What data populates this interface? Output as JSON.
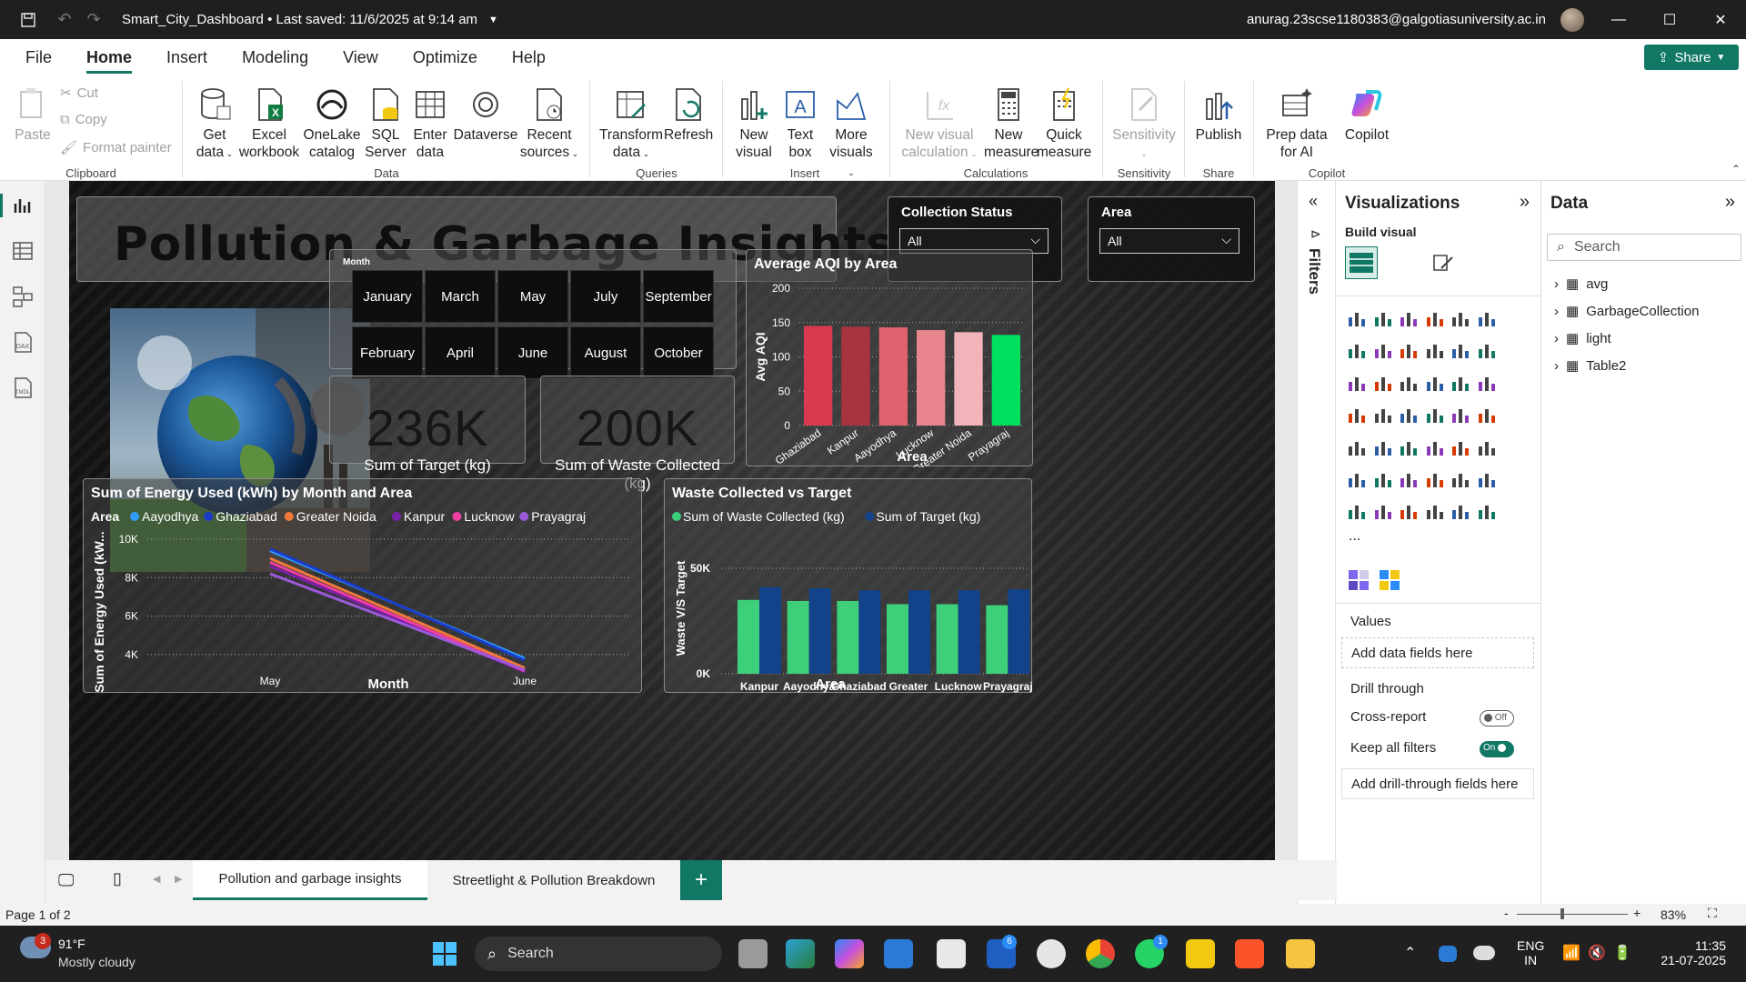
{
  "titlebar": {
    "doc_title": "Smart_City_Dashboard • Last saved: 11/6/2025 at 9:14 am",
    "user": "anurag.23scse1180383@galgotiasuniversity.ac.in"
  },
  "menu": {
    "items": [
      "File",
      "Home",
      "Insert",
      "Modeling",
      "View",
      "Optimize",
      "Help"
    ],
    "share": "Share"
  },
  "ribbon": {
    "clipboard": {
      "paste": "Paste",
      "cut": "Cut",
      "copy": "Copy",
      "format_painter": "Format painter",
      "group": "Clipboard"
    },
    "data": {
      "get_data": "Get data",
      "excel": "Excel workbook",
      "onelake": "OneLake catalog",
      "sql": "SQL Server",
      "enter": "Enter data",
      "dataverse": "Dataverse",
      "recent": "Recent sources",
      "group": "Data"
    },
    "queries": {
      "transform": "Transform data",
      "refresh": "Refresh",
      "group": "Queries"
    },
    "insert": {
      "new_visual": "New visual",
      "text_box": "Text box",
      "more_visuals": "More visuals",
      "group": "Insert"
    },
    "calculations": {
      "new_visual_calc": "New visual calculation",
      "new_measure": "New measure",
      "quick_measure": "Quick measure",
      "group": "Calculations"
    },
    "sensitivity": {
      "label": "Sensitivity",
      "group": "Sensitivity"
    },
    "share": {
      "publish": "Publish",
      "group": "Share"
    },
    "copilot": {
      "prep": "Prep data for AI",
      "copilot": "Copilot",
      "group": "Copilot"
    }
  },
  "report": {
    "title": "Pollution & Garbage Insights",
    "slicer_collection": {
      "label": "Collection Status",
      "value": "All"
    },
    "slicer_area": {
      "label": "Area",
      "value": "All"
    },
    "month_slicer": {
      "label": "Month",
      "months": [
        "January",
        "March",
        "May",
        "July",
        "September",
        "February",
        "April",
        "June",
        "August",
        "October"
      ]
    },
    "kpi_target": {
      "value": "236K",
      "label": "Sum of Target (kg)"
    },
    "kpi_waste": {
      "value": "200K",
      "label": "Sum of Waste Collected (kg)"
    }
  },
  "chart_data": [
    {
      "type": "bar",
      "title": "Average AQI by Area",
      "xlabel": "Area",
      "ylabel": "Avg AQI",
      "ylim": [
        0,
        200
      ],
      "yticks": [
        0,
        50,
        100,
        150,
        200
      ],
      "categories": [
        "Ghaziabad",
        "Kanpur",
        "Aayodhya",
        "Lucknow",
        "Greater Noida",
        "Prayagraj"
      ],
      "values": [
        145,
        144,
        143,
        139,
        136,
        132
      ],
      "colors": [
        "#d93a4f",
        "#a9323f",
        "#e0626f",
        "#e8858e",
        "#f2b3b9",
        "#00e060"
      ]
    },
    {
      "type": "line",
      "title": "Sum of Energy Used (kWh) by Month and Area",
      "xlabel": "Month",
      "ylabel": "Sum of Energy Used (kW...",
      "legend_title": "Area",
      "categories": [
        "May",
        "June"
      ],
      "ylim": [
        3000,
        10000
      ],
      "yticks": [
        "4K",
        "6K",
        "8K",
        "10K"
      ],
      "ytick_values": [
        4000,
        6000,
        8000,
        10000
      ],
      "series": [
        {
          "name": "Aayodhya",
          "color": "#2f9cff",
          "values": [
            9400,
            3800
          ]
        },
        {
          "name": "Ghaziabad",
          "color": "#1a3cc8",
          "values": [
            9500,
            3700
          ]
        },
        {
          "name": "Greater Noida",
          "color": "#f07a3a",
          "values": [
            9000,
            3300
          ]
        },
        {
          "name": "Kanpur",
          "color": "#7a1fa8",
          "values": [
            8600,
            3100
          ]
        },
        {
          "name": "Lucknow",
          "color": "#ee3fa0",
          "values": [
            8800,
            3150
          ]
        },
        {
          "name": "Prayagraj",
          "color": "#9b59d8",
          "values": [
            8200,
            3200
          ]
        }
      ]
    },
    {
      "type": "bar",
      "title": "Waste Collected vs Target",
      "xlabel": "Area",
      "ylabel": "Waste V/S Target",
      "ylim": [
        0,
        60000
      ],
      "yticks": [
        "0K",
        "50K"
      ],
      "ytick_values": [
        0,
        50000
      ],
      "categories": [
        "Kanpur",
        "Aayodhya",
        "Ghaziabad",
        "Greater Noida",
        "Lucknow",
        "Prayagraj"
      ],
      "series": [
        {
          "name": "Sum of Waste Collected (kg)",
          "color": "#3ecf7a",
          "values": [
            35000,
            34500,
            34500,
            33000,
            33000,
            32500
          ]
        },
        {
          "name": "Sum of Target (kg)",
          "color": "#12438a",
          "values": [
            41000,
            40500,
            39500,
            39500,
            39500,
            40000
          ]
        }
      ]
    }
  ],
  "filters_label": "Filters",
  "visualizations": {
    "title": "Visualizations",
    "build_visual": "Build visual",
    "values": "Values",
    "add_data": "Add data fields here",
    "drill_through": "Drill through",
    "cross_report": "Cross-report",
    "cross_report_state": "Off",
    "keep_filters": "Keep all filters",
    "keep_filters_state": "On",
    "add_drill": "Add drill-through fields here",
    "more": "..."
  },
  "data_pane": {
    "title": "Data",
    "search_placeholder": "Search",
    "tables": [
      "avg",
      "GarbageCollection",
      "light",
      "Table2"
    ]
  },
  "tabs": [
    "Pollution and garbage insights",
    "Streetlight & Pollution Breakdown"
  ],
  "status": {
    "page": "Page 1 of 2",
    "zoom": "83%"
  },
  "taskbar": {
    "weather_temp": "91°F",
    "weather_desc": "Mostly cloudy",
    "weather_badge": "3",
    "search": "Search",
    "lang1": "ENG",
    "lang2": "IN",
    "time": "11:35",
    "date": "21-07-2025",
    "badge_l": "6",
    "badge_wa": "1"
  }
}
